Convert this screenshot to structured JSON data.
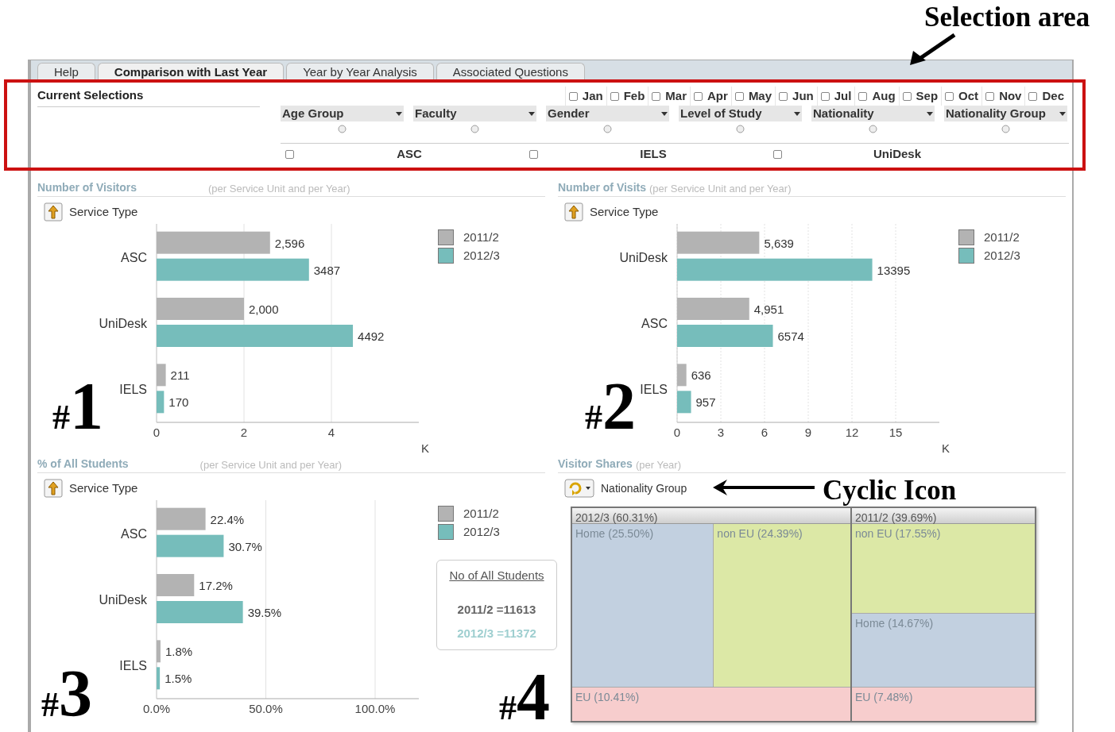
{
  "annotations": {
    "title": "Selection area",
    "markers": [
      "#1",
      "#2",
      "#3",
      "#4"
    ],
    "callout": "Cyclic Icon"
  },
  "tabs": [
    {
      "label": "Help",
      "selected": false
    },
    {
      "label": "Comparison with Last Year",
      "selected": true
    },
    {
      "label": "Year by Year Analysis",
      "selected": false
    },
    {
      "label": "Associated Questions",
      "selected": false
    }
  ],
  "current_selections": "Current Selections",
  "months": [
    {
      "label": "Jan",
      "checked": false
    },
    {
      "label": "Feb",
      "checked": false
    },
    {
      "label": "Mar",
      "checked": false
    },
    {
      "label": "Apr",
      "checked": false
    },
    {
      "label": "May",
      "checked": false
    },
    {
      "label": "Jun",
      "checked": false
    },
    {
      "label": "Jul",
      "checked": false
    },
    {
      "label": "Aug",
      "checked": false
    },
    {
      "label": "Sep",
      "checked": false
    },
    {
      "label": "Oct",
      "checked": false
    },
    {
      "label": "Nov",
      "checked": false
    },
    {
      "label": "Dec",
      "checked": false
    }
  ],
  "filters": [
    "Age Group",
    "Faculty",
    "Gender",
    "Level of Study",
    "Nationality",
    "Nationality Group"
  ],
  "service_units": [
    {
      "label": "ASC",
      "checked": false
    },
    {
      "label": "IELS",
      "checked": false
    },
    {
      "label": "UniDesk",
      "checked": false
    }
  ],
  "panels": [
    {
      "title": "Number of Visitors",
      "subtitle": "(per Service Unit and per Year)",
      "dimension": "Service Type",
      "chart_data": {
        "type": "bar",
        "orientation": "horizontal",
        "xlabel": "K",
        "categories": [
          "ASC",
          "UniDesk",
          "IELS"
        ],
        "series": [
          {
            "name": "2011/2",
            "color": "#b3b3b3",
            "values": [
              2.596,
              2.0,
              0.211
            ]
          },
          {
            "name": "2012/3",
            "color": "#76bdbb",
            "values": [
              3.487,
              4.492,
              0.17
            ]
          }
        ],
        "xlim": [
          0,
          6
        ],
        "xticks": [
          0,
          2,
          4
        ],
        "grid": true,
        "value_labels": [
          [
            "2,596",
            "2,000",
            "211"
          ],
          [
            "3487",
            "4492",
            "170"
          ]
        ]
      }
    },
    {
      "title": "Number of Visits",
      "subtitle": "(per Service Unit and per Year)",
      "dimension": "Service Type",
      "chart_data": {
        "type": "bar",
        "orientation": "horizontal",
        "xlabel": "K",
        "categories": [
          "UniDesk",
          "ASC",
          "IELS"
        ],
        "series": [
          {
            "name": "2011/2",
            "color": "#b3b3b3",
            "values": [
              5.639,
              4.951,
              0.636
            ]
          },
          {
            "name": "2012/3",
            "color": "#76bdbb",
            "values": [
              13.395,
              6.574,
              0.957
            ]
          }
        ],
        "xlim": [
          0,
          18
        ],
        "xticks": [
          0,
          3,
          6,
          9,
          12,
          15
        ],
        "grid": true,
        "value_labels": [
          [
            "5,639",
            "4,951",
            "636"
          ],
          [
            "13395",
            "6574",
            "957"
          ]
        ]
      }
    },
    {
      "title": "% of All Students",
      "subtitle": "(per Service Unit and per Year)",
      "dimension": "Service Type",
      "chart_data": {
        "type": "bar",
        "orientation": "horizontal",
        "categories": [
          "ASC",
          "UniDesk",
          "IELS"
        ],
        "series": [
          {
            "name": "2011/2",
            "color": "#b3b3b3",
            "values": [
              22.4,
              17.2,
              1.8
            ]
          },
          {
            "name": "2012/3",
            "color": "#76bdbb",
            "values": [
              30.7,
              39.5,
              1.5
            ]
          }
        ],
        "xlim": [
          0,
          120
        ],
        "grid": true,
        "xticks": [
          {
            "value": 0,
            "label": "0.0%"
          },
          {
            "value": 50,
            "label": "50.0%"
          },
          {
            "value": 100,
            "label": "100.0%"
          }
        ],
        "value_labels": [
          [
            "22.4%",
            "17.2%",
            "1.8%"
          ],
          [
            "30.7%",
            "39.5%",
            "1.5%"
          ]
        ]
      }
    }
  ],
  "students_box": {
    "title": "No of All Students",
    "lines": [
      {
        "text": "2011/2 =11613",
        "color": "#666666"
      },
      {
        "text": "2012/3 =11372",
        "color": "#9fcfd0"
      }
    ]
  },
  "shares": {
    "title": "Visitor Shares",
    "subtitle": "(per Year)",
    "dimension": "Nationality Group",
    "groups": [
      {
        "label": "2012/3 (60.31%)",
        "kind": "split",
        "cells": [
          {
            "label": "Home (25.50%)",
            "color": "#c2d0e0"
          },
          {
            "label": "non EU (24.39%)",
            "color": "#dce8a6"
          },
          {
            "label": "EU (10.41%)",
            "color": "#f7cdcd"
          }
        ]
      },
      {
        "label": "2011/2 (39.69%)",
        "kind": "stacked",
        "cells": [
          {
            "label": "non EU (17.55%)",
            "color": "#dce8a6"
          },
          {
            "label": "Home (14.67%)",
            "color": "#c2d0e0"
          },
          {
            "label": "EU (7.48%)",
            "color": "#f7cdcd"
          }
        ]
      }
    ]
  }
}
